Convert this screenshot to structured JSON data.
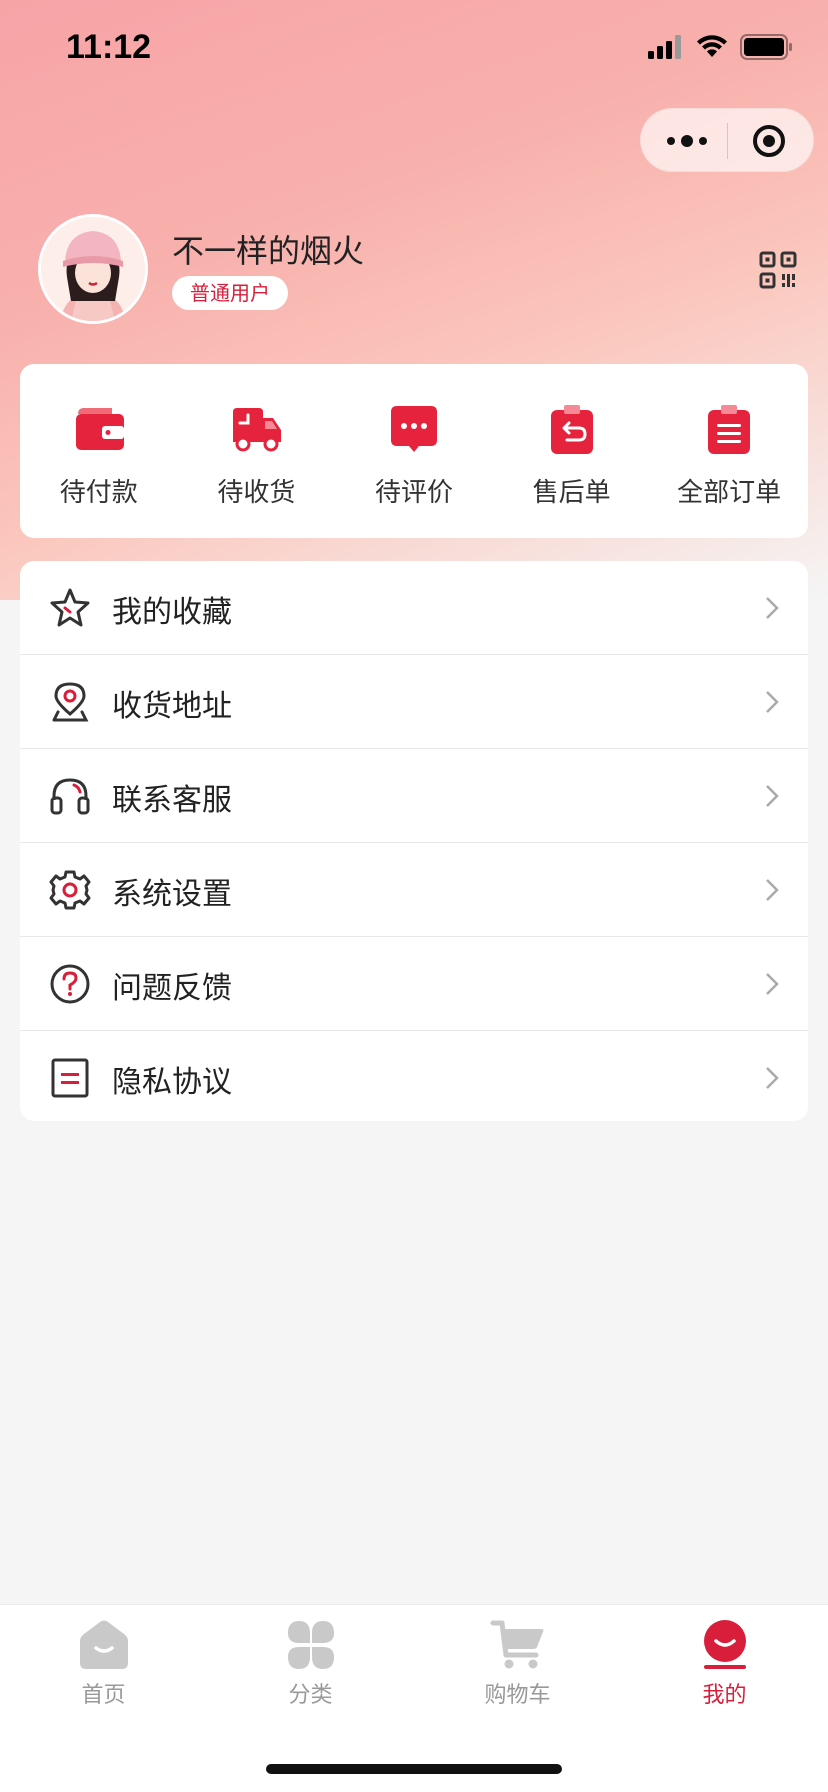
{
  "status_bar": {
    "time": "11:12"
  },
  "capsule": {
    "more_icon": "more-dots-icon",
    "close_icon": "target-icon"
  },
  "profile": {
    "username": "不一样的烟火",
    "tag": "普通用户",
    "qr_icon": "qr-code-icon"
  },
  "orders": {
    "items": [
      {
        "label": "待付款",
        "icon": "wallet-icon"
      },
      {
        "label": "待收货",
        "icon": "truck-icon"
      },
      {
        "label": "待评价",
        "icon": "comment-icon"
      },
      {
        "label": "售后单",
        "icon": "return-icon"
      },
      {
        "label": "全部订单",
        "icon": "list-icon"
      }
    ]
  },
  "menu": {
    "items": [
      {
        "label": "我的收藏",
        "icon": "star-icon"
      },
      {
        "label": "收货地址",
        "icon": "location-icon"
      },
      {
        "label": "联系客服",
        "icon": "headset-icon"
      },
      {
        "label": "系统设置",
        "icon": "gear-icon"
      },
      {
        "label": "问题反馈",
        "icon": "question-icon"
      },
      {
        "label": "隐私协议",
        "icon": "document-icon"
      }
    ]
  },
  "tabbar": {
    "items": [
      {
        "label": "首页",
        "icon": "home-icon",
        "active": false
      },
      {
        "label": "分类",
        "icon": "category-icon",
        "active": false
      },
      {
        "label": "购物车",
        "icon": "cart-icon",
        "active": false
      },
      {
        "label": "我的",
        "icon": "profile-icon",
        "active": true
      }
    ]
  },
  "colors": {
    "accent": "#d81e3a",
    "header_gradient_start": "#f7a4a7",
    "background": "#f5f5f5"
  }
}
